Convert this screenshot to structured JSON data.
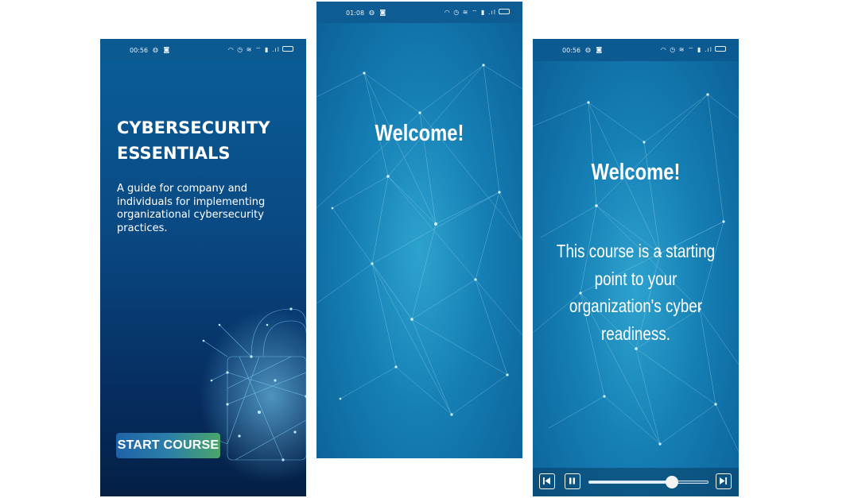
{
  "screens": [
    {
      "status": {
        "time": "00:56"
      },
      "title_lines": [
        "CYBERSECURITY",
        "ESSENTIALS"
      ],
      "description": "A guide for company and individuals for implementing organizational cybersecurity practices.",
      "start_button": "START COURSE",
      "background_image": "padlock-network-graphic"
    },
    {
      "status": {
        "time": "01:08"
      },
      "heading": "Welcome!",
      "background_image": "network-mesh-graphic"
    },
    {
      "status": {
        "time": "00:56"
      },
      "heading": "Welcome!",
      "body": "This course is a starting point to your organization's cyber readiness.",
      "background_image": "network-mesh-graphic",
      "player": {
        "progress": 0.7,
        "controls": [
          "previous-icon",
          "pause-icon",
          "next-icon"
        ]
      }
    }
  ],
  "colors": {
    "statusbar": "#0c5a92",
    "button_gradient_start": "#1f63a8",
    "button_gradient_end": "#4aa56a",
    "text": "#ffffff"
  }
}
